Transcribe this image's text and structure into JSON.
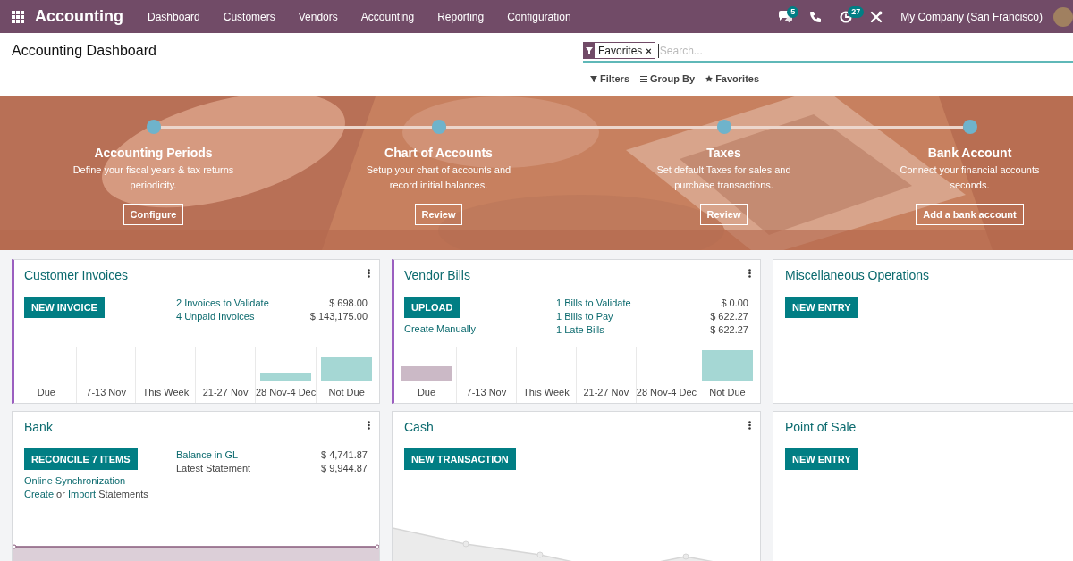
{
  "navbar": {
    "app_name": "Accounting",
    "menu": [
      {
        "label": "Dashboard"
      },
      {
        "label": "Customers"
      },
      {
        "label": "Vendors"
      },
      {
        "label": "Accounting"
      },
      {
        "label": "Reporting"
      },
      {
        "label": "Configuration"
      }
    ],
    "systray": [
      {
        "kind": "chat",
        "badge": "5"
      },
      {
        "kind": "phone"
      },
      {
        "kind": "activity",
        "badge": "27"
      },
      {
        "kind": "tools"
      }
    ],
    "company": "My Company (San Francisco)"
  },
  "control_panel": {
    "title": "Accounting Dashboard",
    "facet": {
      "label": "Favorites",
      "remove": "×"
    },
    "search": {
      "placeholder": "Search..."
    },
    "buttons": [
      {
        "kind": "filter",
        "label": "Filters"
      },
      {
        "kind": "group",
        "label": "Group By"
      },
      {
        "kind": "favorite",
        "label": "Favorites"
      }
    ]
  },
  "onboarding": {
    "steps": [
      {
        "title": "Accounting Periods",
        "lines": [
          "Define your fiscal years & tax returns",
          "periodicity."
        ],
        "button": "Configure"
      },
      {
        "title": "Chart of Accounts",
        "lines": [
          "Setup your chart of accounts and",
          "record initial balances."
        ],
        "button": "Review"
      },
      {
        "title": "Taxes",
        "lines": [
          "Set default Taxes for sales and",
          "purchase transactions."
        ],
        "button": "Review"
      },
      {
        "title": "Bank Account",
        "lines": [
          "Connect your financial accounts",
          "seconds."
        ],
        "button": "Add a bank account"
      }
    ]
  },
  "journals": [
    {
      "title": "Customer Invoices",
      "highlighted": true,
      "menu": true,
      "action": "NEW INVOICE",
      "stats": [
        {
          "label": "2 Invoices to Validate",
          "kind": "link",
          "amount": "$ 698.00"
        },
        {
          "label": "4 Unpaid Invoices",
          "kind": "link",
          "amount": "$ 143,175.00"
        }
      ],
      "graph": {
        "kind": "bar",
        "labels": [
          "Due",
          "7-13 Nov",
          "This Week",
          "21-27 Nov",
          "28 Nov-4 Dec",
          "Not Due"
        ]
      }
    },
    {
      "title": "Vendor Bills",
      "highlighted": true,
      "menu": true,
      "action": "UPLOAD",
      "links": [
        {
          "parts": [
            {
              "text": "Create Manually",
              "kind": "link"
            }
          ]
        }
      ],
      "stats": [
        {
          "label": "1 Bills to Validate",
          "kind": "link",
          "amount": "$ 0.00"
        },
        {
          "label": "1 Bills to Pay",
          "kind": "link",
          "amount": "$ 622.27"
        },
        {
          "label": "1 Late Bills",
          "kind": "link",
          "amount": "$ 622.27"
        }
      ],
      "graph": {
        "kind": "bar",
        "labels": [
          "Due",
          "7-13 Nov",
          "This Week",
          "21-27 Nov",
          "28 Nov-4 Dec",
          "Not Due"
        ]
      }
    },
    {
      "title": "Miscellaneous Operations",
      "highlighted": false,
      "action": "NEW ENTRY"
    },
    {
      "title": "Bank",
      "highlighted": false,
      "menu": true,
      "action": "RECONCILE 7 ITEMS",
      "links": [
        {
          "parts": [
            {
              "text": "Online Synchronization",
              "kind": "link"
            }
          ]
        },
        {
          "parts": [
            {
              "text": "Create",
              "kind": "link"
            },
            {
              "text": "or",
              "kind": "plain"
            },
            {
              "text": "Import",
              "kind": "link"
            },
            {
              "text": "Statements",
              "kind": "plain"
            }
          ]
        }
      ],
      "stats": [
        {
          "label": "Balance in GL",
          "kind": "link",
          "amount": "$ 4,741.87"
        },
        {
          "label": "Latest Statement",
          "kind": "plain",
          "amount": "$ 9,944.87"
        }
      ],
      "graph": {
        "kind": "line"
      }
    },
    {
      "title": "Cash",
      "highlighted": false,
      "menu": true,
      "action": "NEW TRANSACTION",
      "graph": {
        "kind": "area"
      }
    },
    {
      "title": "Point of Sale",
      "highlighted": false,
      "action": "NEW ENTRY"
    }
  ]
}
